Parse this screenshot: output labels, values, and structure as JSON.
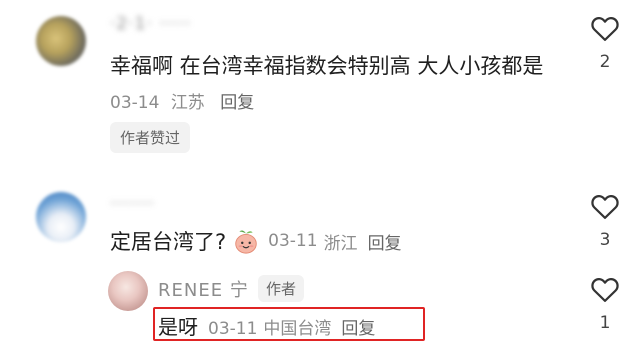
{
  "comments": [
    {
      "username": "·2·1· ·····",
      "text": "幸福啊 在台湾幸福指数会特别高 大人小孩都是",
      "date": "03-14",
      "location": "江苏",
      "reply_label": "回复",
      "likes": "2",
      "tag": "作者赞过"
    },
    {
      "username": "·······",
      "text": "定居台湾了?",
      "emoji": "peach-emoji",
      "date": "03-11",
      "location": "浙江",
      "reply_label": "回复",
      "likes": "3"
    }
  ],
  "reply": {
    "username": "RENEE 宁",
    "author_badge": "作者",
    "text": "是呀",
    "date": "03-11",
    "location": "中国台湾",
    "reply_label": "回复",
    "likes": "1",
    "highlight_color": "#e02424"
  },
  "icons": {
    "like": "heart-outline-icon"
  }
}
